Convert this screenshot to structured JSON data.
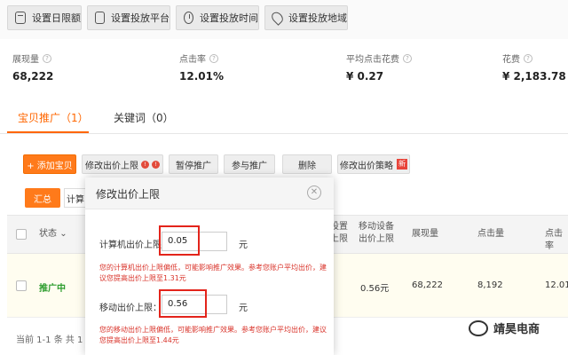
{
  "toolbar": {
    "buttons": [
      {
        "label": "设置日限额",
        "icon": "calendar-icon"
      },
      {
        "label": "设置投放平台",
        "icon": "platform-icon"
      },
      {
        "label": "设置投放时间",
        "icon": "clock-icon"
      },
      {
        "label": "设置投放地域",
        "icon": "location-icon"
      }
    ]
  },
  "stats": [
    {
      "label": "展现量",
      "value": "68,222"
    },
    {
      "label": "点击率",
      "value": "12.01%"
    },
    {
      "label": "平均点击花费",
      "value": "¥ 0.27"
    },
    {
      "label": "花费",
      "value": "¥ 2,183.78"
    }
  ],
  "tabs": [
    {
      "label": "宝贝推广（1）",
      "active": true
    },
    {
      "label": "关键词（0）",
      "active": false
    }
  ],
  "actions": {
    "add": "+ 添加宝贝",
    "modify_limit": "修改出价上限",
    "modify_limit_badge_1": "!",
    "modify_limit_badge_2": "!",
    "pause": "暂停推广",
    "join": "参与推广",
    "delete": "删除",
    "modify_strategy": "修改出价策略",
    "new_tag": "新"
  },
  "summary": {
    "active": "汇总",
    "other": "计算"
  },
  "table": {
    "headers": {
      "status": "状态",
      "partial_col": "设置",
      "partial_col_2": "上限",
      "mobile_limit_1": "移动设备",
      "mobile_limit_2": "出价上限",
      "impressions": "展现量",
      "clicks": "点击量",
      "ctr": "点击率"
    },
    "row": {
      "status": "推广中",
      "mobile_limit": "0.56元",
      "impressions": "68,222",
      "clicks": "8,192",
      "ctr": "12.01"
    }
  },
  "pager": "当前 1-1 条   共 1 条",
  "modal": {
    "title": "修改出价上限",
    "close": "✕",
    "pc_label": "计算机出价上限：",
    "pc_value": "0.05",
    "pc_unit": "元",
    "pc_warning": "您的计算机出价上限偏低，可能影响推广效果。参考您账户平均出价，建议您提高出价上限至1.31元",
    "mobile_label": "移动出价上限：",
    "mobile_value": "0.56",
    "mobile_unit": "元",
    "mobile_warning": "您的移动出价上限偏低，可能影响推广效果。参考您账户平均出价，建议您提高出价上限至1.44元"
  },
  "watermark": "靖昊电商",
  "colors": {
    "accent": "#ff7a1a",
    "active_tab": "#ff6600",
    "warning": "#d9332a",
    "highlight_box": "#e3241b",
    "status_active": "#2e9d2e"
  }
}
